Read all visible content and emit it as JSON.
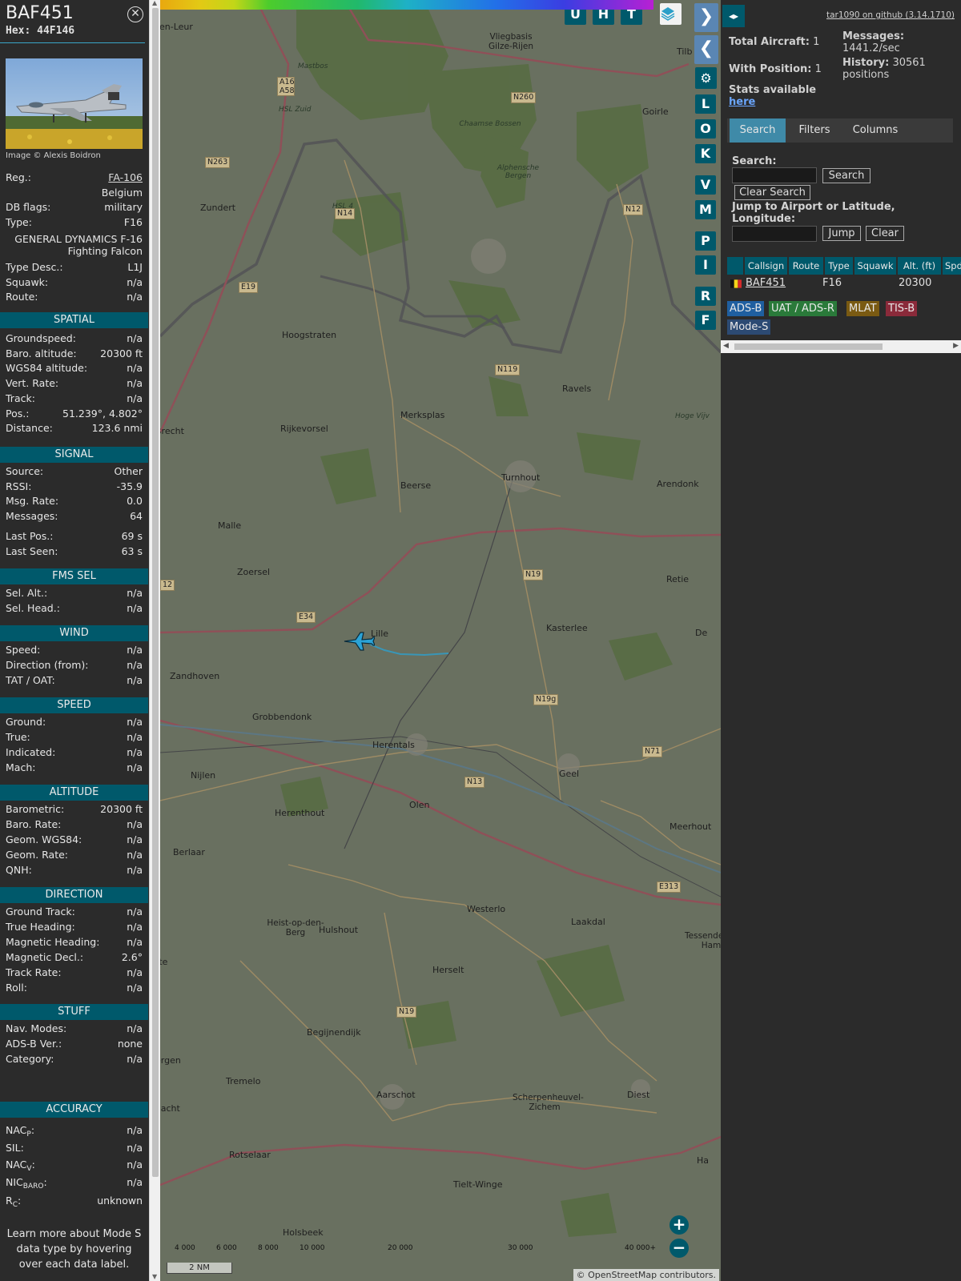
{
  "info": {
    "callsign": "BAF451",
    "hex": "Hex:  44F146",
    "photo_credit": "Image © Alexis Boidron",
    "reg_label": "Reg.:",
    "reg_value": "FA-106",
    "country": "Belgium",
    "dbflags_label": "DB flags:",
    "dbflags_value": "military",
    "type_label": "Type:",
    "type_value": "F16",
    "type_full": "GENERAL DYNAMICS F-16 Fighting Falcon",
    "typedesc_label": "Type Desc.:",
    "typedesc_value": "L1J",
    "squawk_label": "Squawk:",
    "squawk_value": "n/a",
    "route_label": "Route:",
    "route_value": "n/a",
    "spatial": {
      "title": "SPATIAL",
      "rows": [
        {
          "k": "Groundspeed:",
          "v": "n/a"
        },
        {
          "k": "Baro. altitude:",
          "v": "20300 ft"
        },
        {
          "k": "WGS84 altitude:",
          "v": "n/a"
        },
        {
          "k": "Vert. Rate:",
          "v": "n/a"
        },
        {
          "k": "Track:",
          "v": "n/a"
        },
        {
          "k": "Pos.:",
          "v": "51.239°, 4.802°"
        },
        {
          "k": "Distance:",
          "v": "123.6 nmi"
        }
      ]
    },
    "signal": {
      "title": "SIGNAL",
      "rows": [
        {
          "k": "Source:",
          "v": "Other"
        },
        {
          "k": "RSSI:",
          "v": "-35.9"
        },
        {
          "k": "Msg. Rate:",
          "v": "0.0"
        },
        {
          "k": "Messages:",
          "v": "64"
        },
        {
          "k": "Last Pos.:",
          "v": "69 s"
        },
        {
          "k": "Last Seen:",
          "v": "63 s"
        }
      ]
    },
    "fmssel": {
      "title": "FMS SEL",
      "rows": [
        {
          "k": "Sel. Alt.:",
          "v": "n/a"
        },
        {
          "k": "Sel. Head.:",
          "v": "n/a"
        }
      ]
    },
    "wind": {
      "title": "WIND",
      "rows": [
        {
          "k": "Speed:",
          "v": "n/a"
        },
        {
          "k": "Direction (from):",
          "v": "n/a"
        },
        {
          "k": "TAT / OAT:",
          "v": "n/a"
        }
      ]
    },
    "speed": {
      "title": "SPEED",
      "rows": [
        {
          "k": "Ground:",
          "v": "n/a"
        },
        {
          "k": "True:",
          "v": "n/a"
        },
        {
          "k": "Indicated:",
          "v": "n/a"
        },
        {
          "k": "Mach:",
          "v": "n/a"
        }
      ]
    },
    "altitude": {
      "title": "ALTITUDE",
      "rows": [
        {
          "k": "Barometric:",
          "v": "20300 ft"
        },
        {
          "k": "Baro. Rate:",
          "v": "n/a"
        },
        {
          "k": "Geom. WGS84:",
          "v": "n/a"
        },
        {
          "k": "Geom. Rate:",
          "v": "n/a"
        },
        {
          "k": "QNH:",
          "v": "n/a"
        }
      ]
    },
    "direction": {
      "title": "DIRECTION",
      "rows": [
        {
          "k": "Ground Track:",
          "v": "n/a"
        },
        {
          "k": "True Heading:",
          "v": "n/a"
        },
        {
          "k": "Magnetic Heading:",
          "v": "n/a"
        },
        {
          "k": "Magnetic Decl.:",
          "v": "2.6°"
        },
        {
          "k": "Track Rate:",
          "v": "n/a"
        },
        {
          "k": "Roll:",
          "v": "n/a"
        }
      ]
    },
    "stuff": {
      "title": "STUFF",
      "rows": [
        {
          "k": "Nav. Modes:",
          "v": "n/a"
        },
        {
          "k": "ADS-B Ver.:",
          "v": "none"
        },
        {
          "k": "Category:",
          "v": "n/a"
        }
      ]
    },
    "accuracy": {
      "title": "ACCURACY",
      "nacp": "NAC",
      "nacp_sub": "P",
      "nacp_v": "n/a",
      "sil": "SIL:",
      "sil_v": "n/a",
      "nacv": "NAC",
      "nacv_sub": "V",
      "nacv_v": "n/a",
      "nic": "NIC",
      "nic_sub": "BARO",
      "nic_v": "n/a",
      "rc": "R",
      "rc_sub": "C",
      "rc_v": "unknown"
    },
    "footer": "Learn more about Mode S data type by hovering over each data label."
  },
  "map": {
    "top_buttons": [
      "U",
      "H",
      "T"
    ],
    "side_buttons": [
      "L",
      "O",
      "K",
      "V",
      "M",
      "P",
      "I",
      "R",
      "F"
    ],
    "places": [
      {
        "name": "Zundert"
      },
      {
        "name": "Hoogstraten"
      },
      {
        "name": "Rijkevorsel"
      },
      {
        "name": "Merksplas"
      },
      {
        "name": "Ravels"
      },
      {
        "name": "Turnhout"
      },
      {
        "name": "Beerse"
      },
      {
        "name": "Arendonk"
      },
      {
        "name": "Malle"
      },
      {
        "name": "Zoersel"
      },
      {
        "name": "Lille"
      },
      {
        "name": "Kasterlee"
      },
      {
        "name": "Retie"
      },
      {
        "name": "Zandhoven"
      },
      {
        "name": "Grobbendonk"
      },
      {
        "name": "Herentals"
      },
      {
        "name": "Nijlen"
      },
      {
        "name": "Geel"
      },
      {
        "name": "Olen"
      },
      {
        "name": "Herenthout"
      },
      {
        "name": "Meerhout"
      },
      {
        "name": "Berlaar"
      },
      {
        "name": "Westerlo"
      },
      {
        "name": "Laakdal"
      },
      {
        "name": "Heist-op-den-Berg"
      },
      {
        "name": "Hulshout"
      },
      {
        "name": "Herselt"
      },
      {
        "name": "Tessenderlo-Ham"
      },
      {
        "name": "Begijnendijk"
      },
      {
        "name": "Tremelo"
      },
      {
        "name": "Aarschot"
      },
      {
        "name": "Scherpenheuvel-Zichem"
      },
      {
        "name": "Diest"
      },
      {
        "name": "Rotselaar"
      },
      {
        "name": "Tielt-Winge"
      },
      {
        "name": "Holsbeek"
      },
      {
        "name": "Brecht"
      },
      {
        "name": "Goirle"
      },
      {
        "name": "Tilb"
      },
      {
        "name": "en-Leur"
      },
      {
        "name": "Mastbos"
      },
      {
        "name": "Chaamse Bossen"
      },
      {
        "name": "Alphensche Bergen"
      },
      {
        "name": "Vliegbasis Gilze-Rijen"
      },
      {
        "name": "Hoge Vijv"
      },
      {
        "name": "HSL Zuid"
      },
      {
        "name": "HSL 4"
      },
      {
        "name": "ergen"
      },
      {
        "name": "aacht"
      },
      {
        "name": "tte"
      },
      {
        "name": "De"
      },
      {
        "name": "Ha"
      }
    ],
    "roads": [
      "N263",
      "N14",
      "N260",
      "N12",
      "A16 A58",
      "E19",
      "N119",
      "E34",
      "N19",
      "N19g",
      "N13",
      "N71",
      "E313",
      "N19",
      "12"
    ],
    "colorbar_labels": [
      "4 000",
      "6 000",
      "8 000",
      "10 000",
      "20 000",
      "30 000",
      "40 000+"
    ],
    "scale": "2 NM",
    "attribution": "© OpenStreetMap contributors.",
    "zoom_in": "+",
    "zoom_out": "−"
  },
  "right": {
    "toggle": "◂▸",
    "github": "tar1090 on github (3.14.1710)",
    "total_label": "Total Aircraft:",
    "total_value": "1",
    "withpos_label": "With Position:",
    "withpos_value": "1",
    "stats_label": "Stats available",
    "stats_link": "here",
    "messages_label": "Messages:",
    "messages_value": "1441.2/sec",
    "history_label": "History:",
    "history_value": "30561 positions",
    "tabs": [
      "Search",
      "Filters",
      "Columns"
    ],
    "search_label": "Search:",
    "search_button": "Search",
    "clear_search_button": "Clear Search",
    "jump_label": "Jump to Airport or Latitude, Longitude:",
    "jump_button": "Jump",
    "clear_button": "Clear",
    "table": {
      "headers": [
        "Callsign",
        "Route",
        "Type",
        "Squawk",
        "Alt. (ft)",
        "Spd."
      ],
      "row": {
        "callsign": "BAF451",
        "route": "",
        "type": "F16",
        "squawk": "",
        "alt": "20300"
      }
    },
    "sources": [
      {
        "label": "ADS-B",
        "color": "#1f5fa0"
      },
      {
        "label": "UAT / ADS-R",
        "color": "#2a7a3a"
      },
      {
        "label": "MLAT",
        "color": "#7a5a12"
      },
      {
        "label": "TIS-B",
        "color": "#8a2a3a"
      },
      {
        "label": "Mode-S",
        "color": "#2c4a73"
      }
    ]
  }
}
